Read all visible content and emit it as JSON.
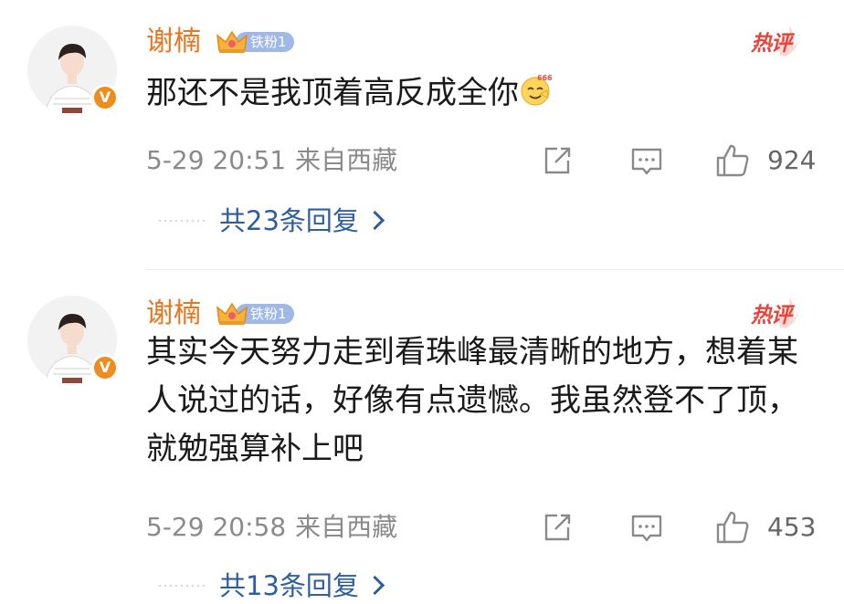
{
  "comments": [
    {
      "username": "谢楠",
      "badge_label": "铁粉1",
      "verified_mark": "V",
      "hot_tag": "热评",
      "text": "那还不是我顶着高反成全你",
      "emoji": "666",
      "timestamp": "5-29 20:51",
      "source": "来自西藏",
      "like_count": "924",
      "replies_label": "共23条回复"
    },
    {
      "username": "谢楠",
      "badge_label": "铁粉1",
      "verified_mark": "V",
      "hot_tag": "热评",
      "text": "其实今天努力走到看珠峰最清晰的地方，想着某人说过的话，好像有点遗憾。我虽然登不了顶，就勉强算补上吧",
      "timestamp": "5-29 20:58",
      "source": "来自西藏",
      "like_count": "453",
      "replies_label": "共13条回复"
    }
  ],
  "icons": {
    "share": "share-icon",
    "comment": "comment-icon",
    "like": "thumbs-up-icon",
    "crown": "crown-icon",
    "verified": "verified-icon",
    "emoji": "emoji-666-icon",
    "chevron": "chevron-right-icon"
  },
  "colors": {
    "username": "#e8761e",
    "verified": "#f08c1e",
    "badge_pill": "#9fb8e8",
    "hot_tag": "#e8443a",
    "replies_link": "#2e5e9e",
    "meta_text": "#8a8a8a"
  }
}
